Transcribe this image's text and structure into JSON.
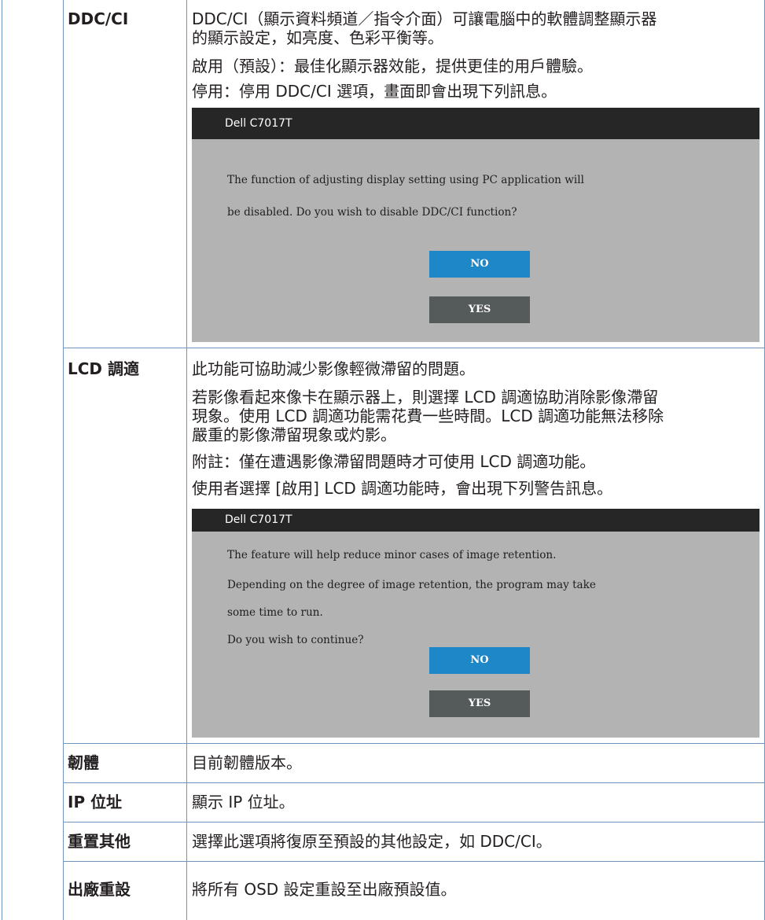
{
  "colors": {
    "border": "#6f95bf",
    "osd_background": "#b3b3b3",
    "osd_titlebar": "#262626",
    "no_button": "#1e87c8",
    "yes_button": "#555a5b"
  },
  "rows": {
    "ddcci": {
      "label": "DDC/CI",
      "lines": [
        "DDC/CI（顯示資料頻道／指令介面）可讓電腦中的軟體調整顯示器",
        "的顯示設定，如亮度、色彩平衡等。",
        "啟用（預設）：最佳化顯示器效能，提供更佳的用戶體驗。",
        "停用：停用 DDC/CI 選項，畫面即會出現下列訊息。"
      ],
      "dialog": {
        "title": "Dell  C7017T",
        "lines": [
          "The function of adjusting display setting using PC application will",
          "be disabled. Do you wish to disable DDC/CI function?"
        ],
        "no_label": "NO",
        "yes_label": "YES"
      }
    },
    "lcd_conditioning": {
      "label": "LCD 調適",
      "lines": [
        "此功能可協助減少影像輕微滯留的問題。",
        "若影像看起來像卡在顯示器上，則選擇 LCD 調適協助消除影像滯留",
        "現象。使用 LCD 調適功能需花費一些時間。LCD 調適功能無法移除",
        "嚴重的影像滯留現象或灼影。",
        "附註：僅在遭遇影像滯留問題時才可使用 LCD 調適功能。",
        "使用者選擇 [啟用] LCD 調適功能時，會出現下列警告訊息。"
      ],
      "dialog": {
        "title": "Dell  C7017T",
        "lines": [
          "The feature will help reduce minor cases of image retention.",
          "Depending on the degree of image retention, the program may take",
          "some time to run.",
          "Do you wish to continue?"
        ],
        "no_label": "NO",
        "yes_label": "YES"
      }
    },
    "firmware": {
      "label": "韌體",
      "text": "目前韌體版本。"
    },
    "ip_address": {
      "label": "IP 位址",
      "text": "顯示 IP 位址。"
    },
    "reset_others": {
      "label": "重置其他",
      "text": "選擇此選項將復原至預設的其他設定，如 DDC/CI。"
    },
    "factory_reset": {
      "label": "出廠重設",
      "text": "將所有 OSD 設定重設至出廠預設值。"
    }
  }
}
